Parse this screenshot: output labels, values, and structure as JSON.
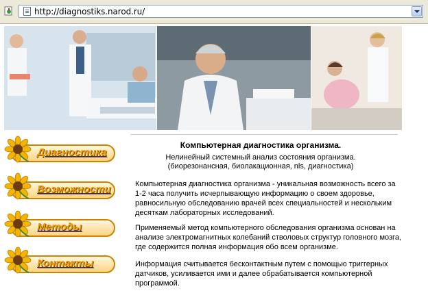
{
  "browser": {
    "url": "http://diagnostiks.narod.ru/"
  },
  "nav": {
    "items": [
      {
        "label": "Диагностика"
      },
      {
        "label": "Возможности"
      },
      {
        "label": "Методы"
      },
      {
        "label": "Контакты"
      }
    ]
  },
  "main": {
    "title": "Компьютерная диагностика организма.",
    "subtitle_line1": "Нелинейный системный анализ состояния организма.",
    "subtitle_line2": "(биорезонансная, биолакационная, nls, диагностика)",
    "paragraphs": [
      "Компьютерная диагностика организма - уникальная возможность всего за 1-2 часа получить исчерпывающую информацию о своем здоровье, равносильную обследованию врачей всех специальностей и нескольким десяткам лабораторных исследований.",
      "Применяемый метод компьютерного обследования организма основан на анализе электромагнитных колебаний стволовых структур головного мозга, где содержится полная информация обо всем организме.",
      "Информация считывается бесконтактным путем с помощью триггерных датчиков, усиливается ими и далее обрабатывается компьютерной программой."
    ]
  },
  "colors": {
    "nav_text": "#f6a000",
    "nav_border": "#c98400",
    "chrome": "#ece9d8"
  },
  "icons": {
    "page": "page-icon",
    "dropdown": "chevron-down-icon",
    "nav_flower": "sunflower-icon"
  }
}
